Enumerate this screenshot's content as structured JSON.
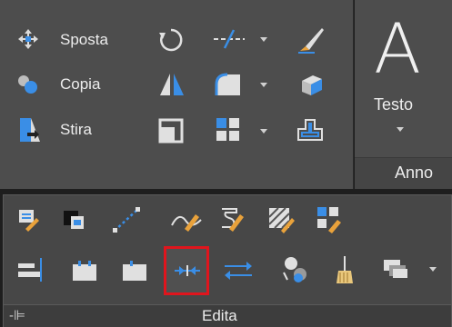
{
  "modify_panel": {
    "items": [
      {
        "label": "Sposta",
        "icon": "move-icon"
      },
      {
        "label": "Copia",
        "icon": "copy-icon"
      },
      {
        "label": "Stira",
        "icon": "stretch-icon"
      }
    ],
    "icons": [
      "rotate-icon",
      "trim-icon",
      "erase-icon",
      "mirror-icon",
      "fillet-icon",
      "explode-icon",
      "scale-icon",
      "array-icon",
      "offset-icon"
    ]
  },
  "annotation_panel": {
    "text_label": "Testo",
    "big_glyph": "A",
    "title": "Anno"
  },
  "edit_panel": {
    "title": "Edita",
    "pin_glyph": "-⊫",
    "row1_icons": [
      "edit-attribute-icon",
      "block-editor-icon",
      "edit-polyline-icon",
      "edit-spline-icon",
      "edit-hatch-icon",
      "edit-array-icon",
      "edit-spline-curve-icon"
    ],
    "row2_icons": [
      "align-icon",
      "break-at-point-icon",
      "break-icon",
      "join-icon",
      "reverse-icon",
      "change-space-icon",
      "overkill-icon",
      "draw-order-icon"
    ],
    "selected": "join-icon"
  },
  "colors": {
    "panel_bg": "#4d4d4d",
    "edit_bg": "#474747",
    "highlight": "#e0151d",
    "accent_blue": "#3a8ee6"
  }
}
